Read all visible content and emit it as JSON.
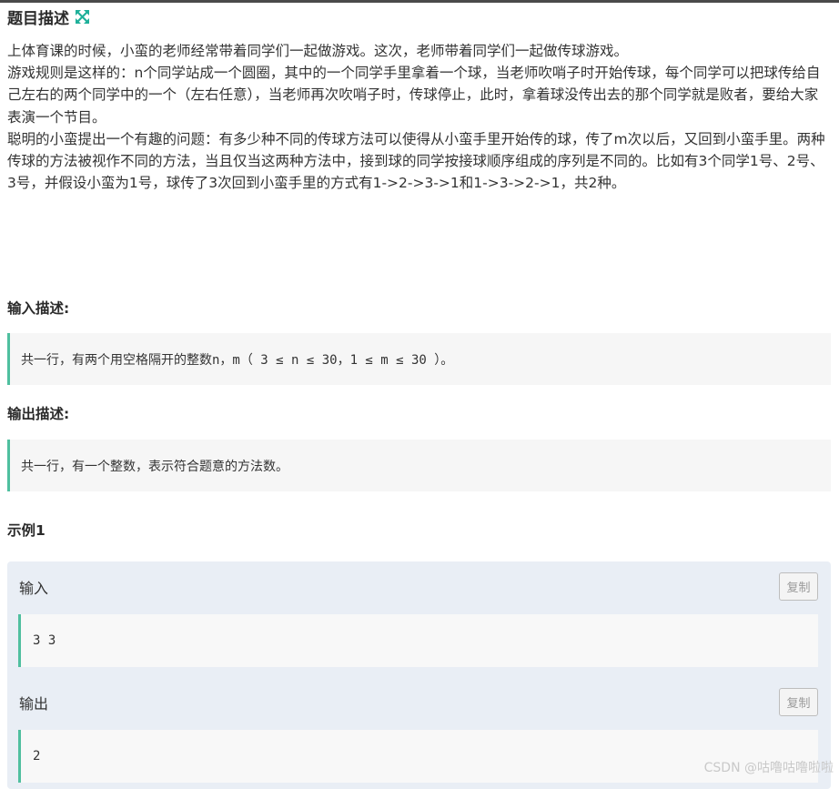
{
  "header": {
    "title": "题目描述",
    "expand_icon": "expand-arrows-icon",
    "accent_color": "#1fb09a"
  },
  "description": {
    "paragraphs": [
      "上体育课的时候，小蛮的老师经常带着同学们一起做游戏。这次，老师带着同学们一起做传球游戏。",
      "游戏规则是这样的：n个同学站成一个圆圈，其中的一个同学手里拿着一个球，当老师吹哨子时开始传球，每个同学可以把球传给自己左右的两个同学中的一个（左右任意），当老师再次吹哨子时，传球停止，此时，拿着球没传出去的那个同学就是败者，要给大家表演一个节目。",
      "聪明的小蛮提出一个有趣的问题：有多少种不同的传球方法可以使得从小蛮手里开始传的球，传了m次以后，又回到小蛮手里。两种传球的方法被视作不同的方法，当且仅当这两种方法中，接到球的同学按接球顺序组成的序列是不同的。比如有3个同学1号、2号、3号，并假设小蛮为1号，球传了3次回到小蛮手里的方式有1->2->3->1和1->3->2->1，共2种。"
    ]
  },
  "input_section": {
    "title": "输入描述:",
    "text": "共一行，有两个用空格隔开的整数n，m（ 3 ≤ n ≤ 30，1 ≤ m ≤ 30 ）。"
  },
  "output_section": {
    "title": "输出描述:",
    "text": "共一行，有一个整数，表示符合题意的方法数。"
  },
  "example": {
    "title": "示例1",
    "input_label": "输入",
    "input_value": "3 3",
    "output_label": "输出",
    "output_value": "2",
    "copy_label": "复制"
  },
  "watermark": "CSDN @咕噜咕噜啦啦"
}
